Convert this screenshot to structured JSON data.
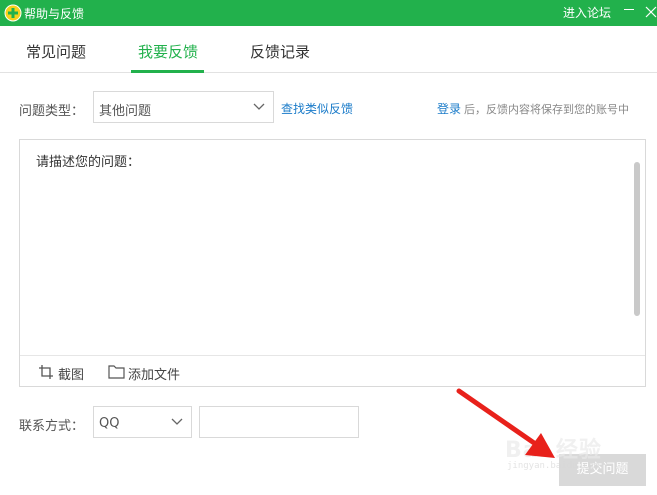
{
  "titlebar": {
    "title": "帮助与反馈",
    "forum_link": "进入论坛",
    "logo_icon": "help-feedback-logo-icon",
    "minimize_icon": "minimize-icon",
    "close_icon": "close-icon",
    "color": "#22b14c"
  },
  "tabs": [
    {
      "label": "常见问题",
      "active": false
    },
    {
      "label": "我要反馈",
      "active": true
    },
    {
      "label": "反馈记录",
      "active": false
    }
  ],
  "form": {
    "type_label": "问题类型：",
    "type_value": "其他问题",
    "find_similar": "查找类似反馈",
    "login_link": "登录",
    "login_note": "后，反馈内容将保存到您的账号中",
    "desc_placeholder": "请描述您的问题：",
    "screenshot_label": "截图",
    "add_file_label": "添加文件",
    "contact_label": "联系方式：",
    "contact_type": "QQ",
    "contact_value": "",
    "submit_label": "提交问题"
  },
  "overlay": {
    "watermark_brand": "Bai 经验",
    "watermark_sub": "jingyan.baidu.com",
    "arrow_color": "#e8211b"
  },
  "colors": {
    "accent": "#22b14c",
    "link": "#1a7bc9",
    "disabled_button": "#d9d9d9"
  }
}
